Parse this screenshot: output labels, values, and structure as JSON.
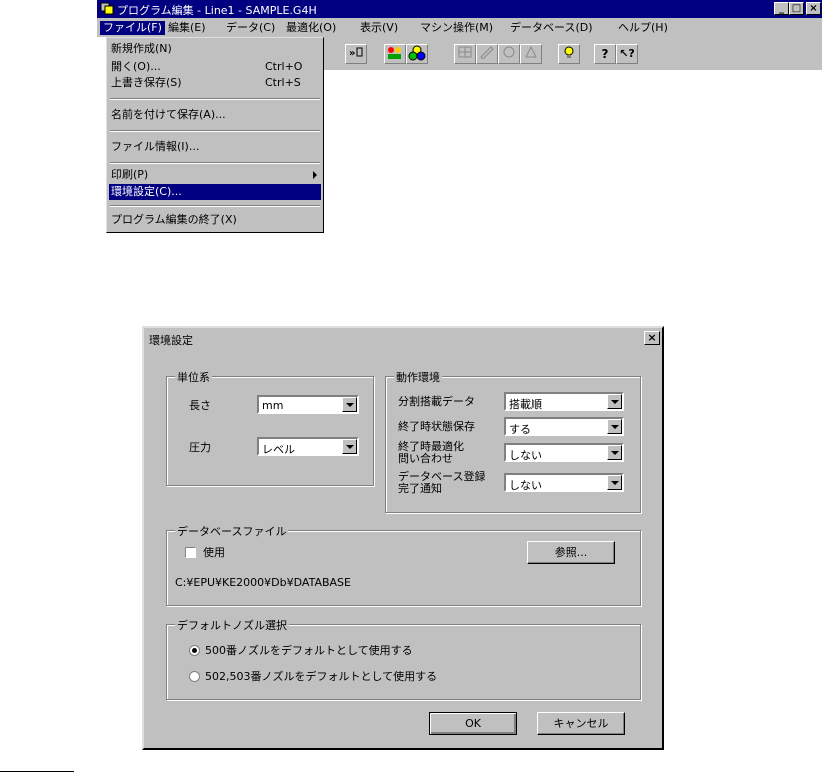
{
  "window": {
    "title": "プログラム編集 - Line1 - SAMPLE.G4H",
    "buttons": {
      "minimize": "_",
      "maximize": "□",
      "close": "×"
    }
  },
  "menubar": [
    {
      "label": "ファイル(F)",
      "active": true
    },
    {
      "label": "編集(E)"
    },
    {
      "label": "データ(C)"
    },
    {
      "label": "最適化(O)"
    },
    {
      "label": "表示(V)"
    },
    {
      "label": "マシン操作(M)"
    },
    {
      "label": "データベース(D)"
    },
    {
      "label": "ヘルプ(H)"
    }
  ],
  "toolbar": {
    "icons": [
      "tool-icon",
      "nozzle-icon",
      "color-icon",
      "grid-icon",
      "edit-icon",
      "part-icon",
      "feeder-icon",
      "bulb-icon",
      "help-icon",
      "context-help-icon"
    ],
    "help_glyph": "?",
    "context_help_glyph": "↖?"
  },
  "file_menu": {
    "items": [
      {
        "label": "新規作成(N)",
        "shortcut": ""
      },
      {
        "label": "開く(O)...",
        "shortcut": "Ctrl+O"
      },
      {
        "label": "上書き保存(S)",
        "shortcut": "Ctrl+S"
      },
      {
        "label": "名前を付けて保存(A)..."
      },
      {
        "label": "ファイル情報(I)..."
      },
      {
        "label": "印刷(P)",
        "submenu": true
      },
      {
        "label": "環境設定(C)...",
        "selected": true
      },
      {
        "label": "プログラム編集の終了(X)"
      }
    ]
  },
  "dialog": {
    "title": "環境設定",
    "close": "×",
    "units": {
      "legend": "単位系",
      "length_label": "長さ",
      "length_value": "mm",
      "pressure_label": "圧力",
      "pressure_value": "レベル"
    },
    "env": {
      "legend": "動作環境",
      "split_label": "分割搭載データ",
      "split_value": "搭載順",
      "save_label": "終了時状態保存",
      "save_value": "する",
      "opt_label1": "終了時最適化",
      "opt_label2": "問い合わせ",
      "opt_value": "しない",
      "db_label1": "データベース登録",
      "db_label2": "完了通知",
      "db_value": "しない"
    },
    "dbfile": {
      "legend": "データベースファイル",
      "use_label": "使用",
      "use_checked": false,
      "browse_label": "参照...",
      "path": "C:¥EPU¥KE2000¥Db¥DATABASE"
    },
    "nozzle": {
      "legend": "デフォルトノズル選択",
      "option1": "500番ノズルをデフォルトとして使用する",
      "option2": "502,503番ノズルをデフォルトとして使用する",
      "selected": 1
    },
    "ok_label": "OK",
    "cancel_label": "キャンセル"
  }
}
